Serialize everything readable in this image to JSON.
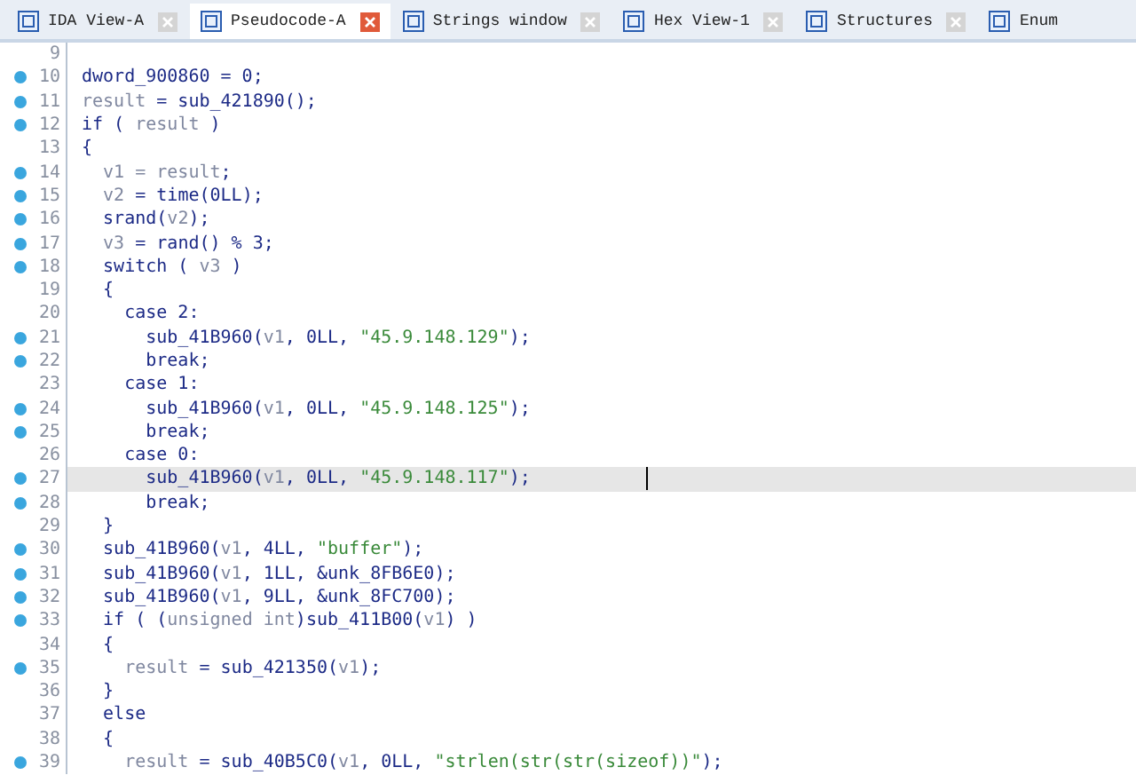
{
  "tabs": [
    {
      "label": "IDA View-A",
      "selected": false
    },
    {
      "label": "Pseudocode-A",
      "selected": true
    },
    {
      "label": "Strings window",
      "selected": false
    },
    {
      "label": "Hex View-1",
      "selected": false
    },
    {
      "label": "Structures",
      "selected": false
    },
    {
      "label": "Enum",
      "selected": false
    }
  ],
  "code": {
    "lines": [
      {
        "number": "9",
        "dot": false,
        "selected": false
      },
      {
        "number": "10",
        "dot": true,
        "selected": false,
        "tokens": [
          {
            "kind": "code",
            "text": "dword_900860 = 0;"
          }
        ]
      },
      {
        "number": "11",
        "dot": true,
        "selected": false,
        "tokens": [
          {
            "kind": "var",
            "text": "result"
          },
          {
            "kind": "code",
            "text": " = sub_421890();"
          }
        ]
      },
      {
        "number": "12",
        "dot": true,
        "selected": false,
        "tokens": [
          {
            "kind": "code",
            "text": "if ( "
          },
          {
            "kind": "var",
            "text": "result"
          },
          {
            "kind": "code",
            "text": " )"
          }
        ]
      },
      {
        "number": "13",
        "dot": false,
        "selected": false,
        "tokens": [
          {
            "kind": "code",
            "text": "{"
          }
        ]
      },
      {
        "number": "14",
        "dot": true,
        "selected": false,
        "tokens": [
          {
            "kind": "var",
            "text": "  v1 = result"
          },
          {
            "kind": "code",
            "text": ";"
          }
        ]
      },
      {
        "number": "15",
        "dot": true,
        "selected": false,
        "tokens": [
          {
            "kind": "var",
            "text": "  v2"
          },
          {
            "kind": "code",
            "text": " = time(0LL);"
          }
        ]
      },
      {
        "number": "16",
        "dot": true,
        "selected": false,
        "tokens": [
          {
            "kind": "code",
            "text": "  srand("
          },
          {
            "kind": "var",
            "text": "v2"
          },
          {
            "kind": "code",
            "text": ");"
          }
        ]
      },
      {
        "number": "17",
        "dot": true,
        "selected": false,
        "tokens": [
          {
            "kind": "var",
            "text": "  v3"
          },
          {
            "kind": "code",
            "text": " = rand() % 3;"
          }
        ]
      },
      {
        "number": "18",
        "dot": true,
        "selected": false,
        "tokens": [
          {
            "kind": "code",
            "text": "  switch ( "
          },
          {
            "kind": "var",
            "text": "v3"
          },
          {
            "kind": "code",
            "text": " )"
          }
        ]
      },
      {
        "number": "19",
        "dot": false,
        "selected": false,
        "tokens": [
          {
            "kind": "code",
            "text": "  {"
          }
        ]
      },
      {
        "number": "20",
        "dot": false,
        "selected": false,
        "tokens": [
          {
            "kind": "code",
            "text": "    case 2:"
          }
        ]
      },
      {
        "number": "21",
        "dot": true,
        "selected": false,
        "tokens": [
          {
            "kind": "code",
            "text": "      sub_41B960("
          },
          {
            "kind": "var",
            "text": "v1"
          },
          {
            "kind": "code",
            "text": ", 0LL, "
          },
          {
            "kind": "str",
            "text": "\"45.9.148.129\""
          },
          {
            "kind": "code",
            "text": ");"
          }
        ]
      },
      {
        "number": "22",
        "dot": true,
        "selected": false,
        "tokens": [
          {
            "kind": "code",
            "text": "      break;"
          }
        ]
      },
      {
        "number": "23",
        "dot": false,
        "selected": false,
        "tokens": [
          {
            "kind": "code",
            "text": "    case 1:"
          }
        ]
      },
      {
        "number": "24",
        "dot": true,
        "selected": false,
        "tokens": [
          {
            "kind": "code",
            "text": "      sub_41B960("
          },
          {
            "kind": "var",
            "text": "v1"
          },
          {
            "kind": "code",
            "text": ", 0LL, "
          },
          {
            "kind": "str",
            "text": "\"45.9.148.125\""
          },
          {
            "kind": "code",
            "text": ");"
          }
        ]
      },
      {
        "number": "25",
        "dot": true,
        "selected": false,
        "tokens": [
          {
            "kind": "code",
            "text": "      break;"
          }
        ]
      },
      {
        "number": "26",
        "dot": false,
        "selected": false,
        "tokens": [
          {
            "kind": "code",
            "text": "    case 0:"
          }
        ]
      },
      {
        "number": "27",
        "dot": true,
        "selected": true,
        "tokens": [
          {
            "kind": "code",
            "text": "      sub_41B960("
          },
          {
            "kind": "var",
            "text": "v1"
          },
          {
            "kind": "code",
            "text": ", 0LL, "
          },
          {
            "kind": "str",
            "text": "\"45.9.148.117\""
          },
          {
            "kind": "code",
            "text": ");"
          }
        ]
      },
      {
        "number": "28",
        "dot": true,
        "selected": false,
        "tokens": [
          {
            "kind": "code",
            "text": "      break;"
          }
        ]
      },
      {
        "number": "29",
        "dot": false,
        "selected": false,
        "tokens": [
          {
            "kind": "code",
            "text": "  }"
          }
        ]
      },
      {
        "number": "30",
        "dot": true,
        "selected": false,
        "tokens": [
          {
            "kind": "code",
            "text": "  sub_41B960("
          },
          {
            "kind": "var",
            "text": "v1"
          },
          {
            "kind": "code",
            "text": ", 4LL, "
          },
          {
            "kind": "str",
            "text": "\"buffer\""
          },
          {
            "kind": "code",
            "text": ");"
          }
        ]
      },
      {
        "number": "31",
        "dot": true,
        "selected": false,
        "tokens": [
          {
            "kind": "code",
            "text": "  sub_41B960("
          },
          {
            "kind": "var",
            "text": "v1"
          },
          {
            "kind": "code",
            "text": ", 1LL, &unk_8FB6E0);"
          }
        ]
      },
      {
        "number": "32",
        "dot": true,
        "selected": false,
        "tokens": [
          {
            "kind": "code",
            "text": "  sub_41B960("
          },
          {
            "kind": "var",
            "text": "v1"
          },
          {
            "kind": "code",
            "text": ", 9LL, &unk_8FC700);"
          }
        ]
      },
      {
        "number": "33",
        "dot": true,
        "selected": false,
        "tokens": [
          {
            "kind": "code",
            "text": "  if ( ("
          },
          {
            "kind": "var",
            "text": "unsigned int"
          },
          {
            "kind": "code",
            "text": ")sub_411B00("
          },
          {
            "kind": "var",
            "text": "v1"
          },
          {
            "kind": "code",
            "text": ") )"
          }
        ]
      },
      {
        "number": "34",
        "dot": false,
        "selected": false,
        "tokens": [
          {
            "kind": "code",
            "text": "  {"
          }
        ]
      },
      {
        "number": "35",
        "dot": true,
        "selected": false,
        "tokens": [
          {
            "kind": "var",
            "text": "    result"
          },
          {
            "kind": "code",
            "text": " = sub_421350("
          },
          {
            "kind": "var",
            "text": "v1"
          },
          {
            "kind": "code",
            "text": ");"
          }
        ]
      },
      {
        "number": "36",
        "dot": false,
        "selected": false,
        "tokens": [
          {
            "kind": "code",
            "text": "  }"
          }
        ]
      },
      {
        "number": "37",
        "dot": false,
        "selected": false,
        "tokens": [
          {
            "kind": "code",
            "text": "  else"
          }
        ]
      },
      {
        "number": "38",
        "dot": false,
        "selected": false,
        "tokens": [
          {
            "kind": "code",
            "text": "  {"
          }
        ]
      },
      {
        "number": "39",
        "dot": true,
        "selected": false,
        "tokens": [
          {
            "kind": "var",
            "text": "    result"
          },
          {
            "kind": "code",
            "text": " = sub_40B5C0("
          },
          {
            "kind": "var",
            "text": "v1"
          },
          {
            "kind": "code",
            "text": ", 0LL, "
          },
          {
            "kind": "str",
            "text": "\"strlen(str(str(sizeof))\""
          },
          {
            "kind": "code",
            "text": ");"
          }
        ]
      }
    ]
  }
}
